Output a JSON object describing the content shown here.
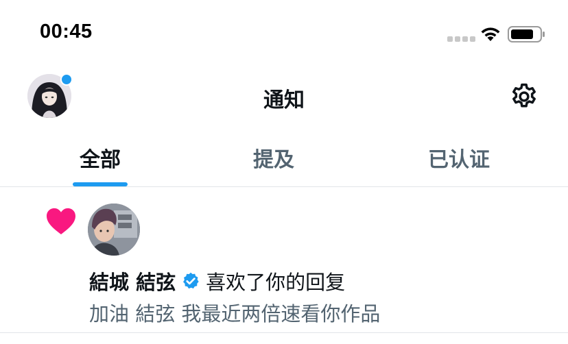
{
  "status_bar": {
    "time": "00:45",
    "signal_icon": "cellular-signal-icon",
    "wifi_icon": "wifi-icon",
    "battery_icon": "battery-icon"
  },
  "header": {
    "title": "通知",
    "avatar_icon": "profile-avatar",
    "settings_icon": "gear-icon"
  },
  "tabs": [
    {
      "label": "全部",
      "active": true
    },
    {
      "label": "提及",
      "active": false
    },
    {
      "label": "已认证",
      "active": false
    }
  ],
  "notification": {
    "type_icon": "heart-icon",
    "username": "結城 結弦",
    "verified_icon": "verified-badge-icon",
    "action": "喜欢了你的回复",
    "preview": "加油 結弦 我最近两倍速看你作品"
  },
  "colors": {
    "accent": "#1d9bf0",
    "heart": "#f91880",
    "primary_text": "#0f1419",
    "secondary_text": "#536471",
    "divider": "#e1e4e8"
  }
}
